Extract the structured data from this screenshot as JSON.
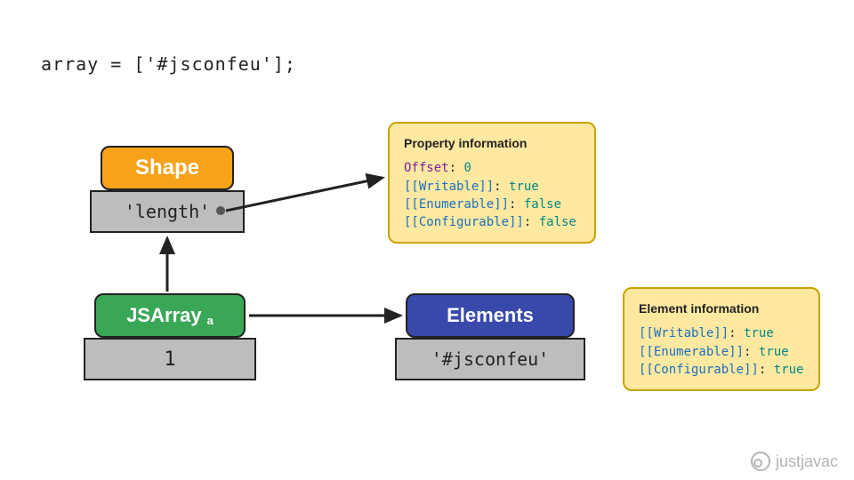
{
  "code_line": "array = ['#jsconfeu'];",
  "shape_box": {
    "title": "Shape",
    "cell": "'length'"
  },
  "jsarray_box": {
    "title": "JSArray",
    "subscript": "a",
    "cell": "1"
  },
  "elements_box": {
    "title": "Elements",
    "cell": "'#jsconfeu'"
  },
  "property_info": {
    "title": "Property information",
    "offset_label": "Offset",
    "offset_value": "0",
    "writable_label": "[[Writable]]",
    "writable_value": "true",
    "enumerable_label": "[[Enumerable]]",
    "enumerable_value": "false",
    "configurable_label": "[[Configurable]]",
    "configurable_value": "false"
  },
  "element_info": {
    "title": "Element information",
    "writable_label": "[[Writable]]",
    "writable_value": "true",
    "enumerable_label": "[[Enumerable]]",
    "enumerable_value": "true",
    "configurable_label": "[[Configurable]]",
    "configurable_value": "true"
  },
  "watermark": "justjavac",
  "colors": {
    "shape": "#f6a21b",
    "jsarray": "#3aa757",
    "elements": "#3949ab"
  }
}
